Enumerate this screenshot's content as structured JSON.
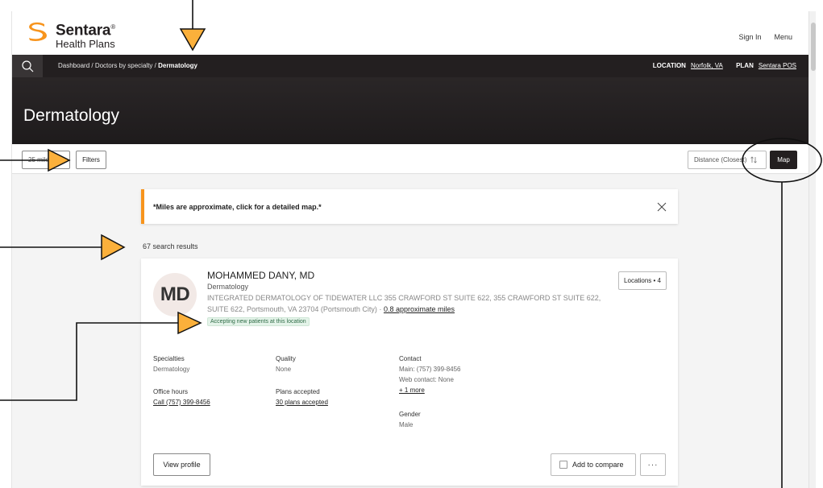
{
  "brand": {
    "name": "Sentara",
    "trademark": "®",
    "subtitle": "Health Plans",
    "logo_color": "#f7941d"
  },
  "top_links": {
    "sign_in": "Sign In",
    "menu": "Menu"
  },
  "navbar": {
    "search_icon": "search-icon",
    "breadcrumb": {
      "item1": "Dashboard /",
      "item2": "Doctors by specialty /",
      "current": "Dermatology"
    },
    "location_label": "LOCATION",
    "location_value": "Norfolk, VA",
    "plan_label": "PLAN",
    "plan_value": "Sentara POS"
  },
  "page_title": "Dermatology",
  "filters": {
    "miles": "25 miles",
    "filters_label": "Filters",
    "sort_label": "Distance (Closest)",
    "sort_icon": "sort-icon",
    "map_label": "Map"
  },
  "notice": {
    "text": "*Miles are approximate, click for a detailed map.*",
    "close_icon": "close-icon"
  },
  "results": {
    "count_text": "67 search results"
  },
  "provider": {
    "initials": "MD",
    "name": "MOHAMMED DANY, MD",
    "specialty": "Dermatology",
    "address": "INTEGRATED DERMATOLOGY OF TIDEWATER LLC 355 CRAWFORD ST SUITE 622, 355 CRAWFORD ST SUITE 622, SUITE 622, Portsmouth, VA 23704 (Portsmouth City) ·",
    "distance": "0.8 approximate miles",
    "accepting": "Accepting new patients at this location",
    "locations_label": "Locations • 4",
    "specialties_label": "Specialties",
    "specialties_value": "Dermatology",
    "quality_label": "Quality",
    "quality_value": "None",
    "contact_label": "Contact",
    "contact_main": "Main: (757) 399-8456",
    "contact_web": "Web contact: None",
    "contact_more": "+ 1 more",
    "office_hours_label": "Office hours",
    "office_hours_value": "Call (757) 399-8456",
    "plans_label": "Plans accepted",
    "plans_value": "30 plans accepted",
    "gender_label": "Gender",
    "gender_value": "Male"
  },
  "actions": {
    "view_profile": "View profile",
    "add_to_compare": "Add to compare",
    "more": "···"
  },
  "colors": {
    "dark_bar": "#231f20",
    "accent": "#f7941d",
    "annotation_arrow": "#fbb03b"
  }
}
